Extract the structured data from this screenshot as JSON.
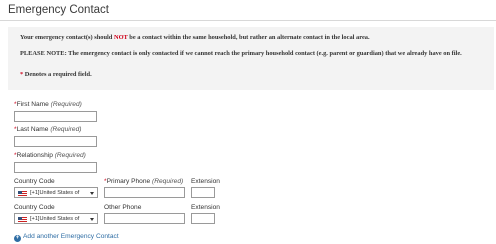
{
  "section": {
    "title": "Emergency Contact"
  },
  "notice": {
    "p1_before": "Your emergency contact(s) should ",
    "p1_emph": "NOT",
    "p1_after": " be a contact within the same household, but rather an alternate contact in the local area.",
    "p2": "PLEASE NOTE: The emergency contact is only contacted if we cannot reach the primary household contact (e.g. parent or guardian) that we already have on file.",
    "p3_star": "*",
    "p3_text": " Denotes a required field."
  },
  "form": {
    "required_marker": "*",
    "required_text": "(Required)",
    "first_name": {
      "label": "First Name",
      "value": ""
    },
    "last_name": {
      "label": "Last Name",
      "value": ""
    },
    "relationship": {
      "label": "Relationship",
      "value": ""
    },
    "phone1": {
      "country_label": "Country Code",
      "country_value": "[+1]United States of",
      "phone_label": "Primary Phone",
      "ext_label": "Extension"
    },
    "phone2": {
      "country_label": "Country Code",
      "country_value": "[+1]United States of",
      "phone_label": "Other Phone",
      "ext_label": "Extension"
    }
  },
  "actions": {
    "add_contact": "Add another Emergency Contact"
  },
  "icons": {
    "add": "plus-circle-icon",
    "flag": "us-flag-icon",
    "caret": "chevron-down-icon"
  },
  "colors": {
    "required": "#d0021b",
    "link": "#2e6da4",
    "notice_bg": "#f3f3f3"
  }
}
